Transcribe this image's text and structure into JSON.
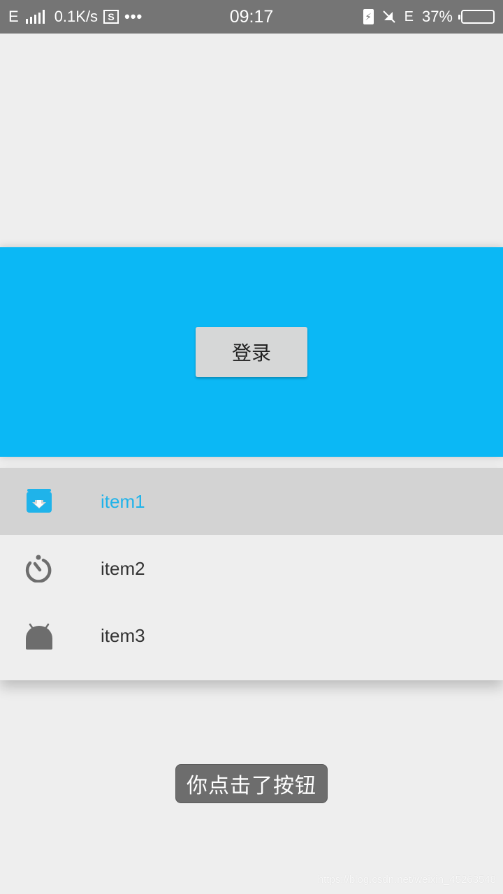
{
  "status_bar": {
    "network_type": "E",
    "speed": "0.1K/s",
    "sim_box": "S",
    "more": "•••",
    "time": "09:17",
    "network_type_2": "E",
    "battery_percent": "37%",
    "battery_level": 0.37
  },
  "header": {
    "login_label": "登录",
    "background_color": "#0bb8f5"
  },
  "menu": {
    "items": [
      {
        "label": "item1",
        "icon": "archive-download-icon",
        "selected": true
      },
      {
        "label": "item2",
        "icon": "timer-icon",
        "selected": false
      },
      {
        "label": "item3",
        "icon": "android-icon",
        "selected": false
      }
    ],
    "selected_color": "#1fb3ea"
  },
  "toast": {
    "message": "你点击了按钮"
  },
  "watermark": {
    "text": "https://blog.csdn.net/weixin_45263548"
  }
}
